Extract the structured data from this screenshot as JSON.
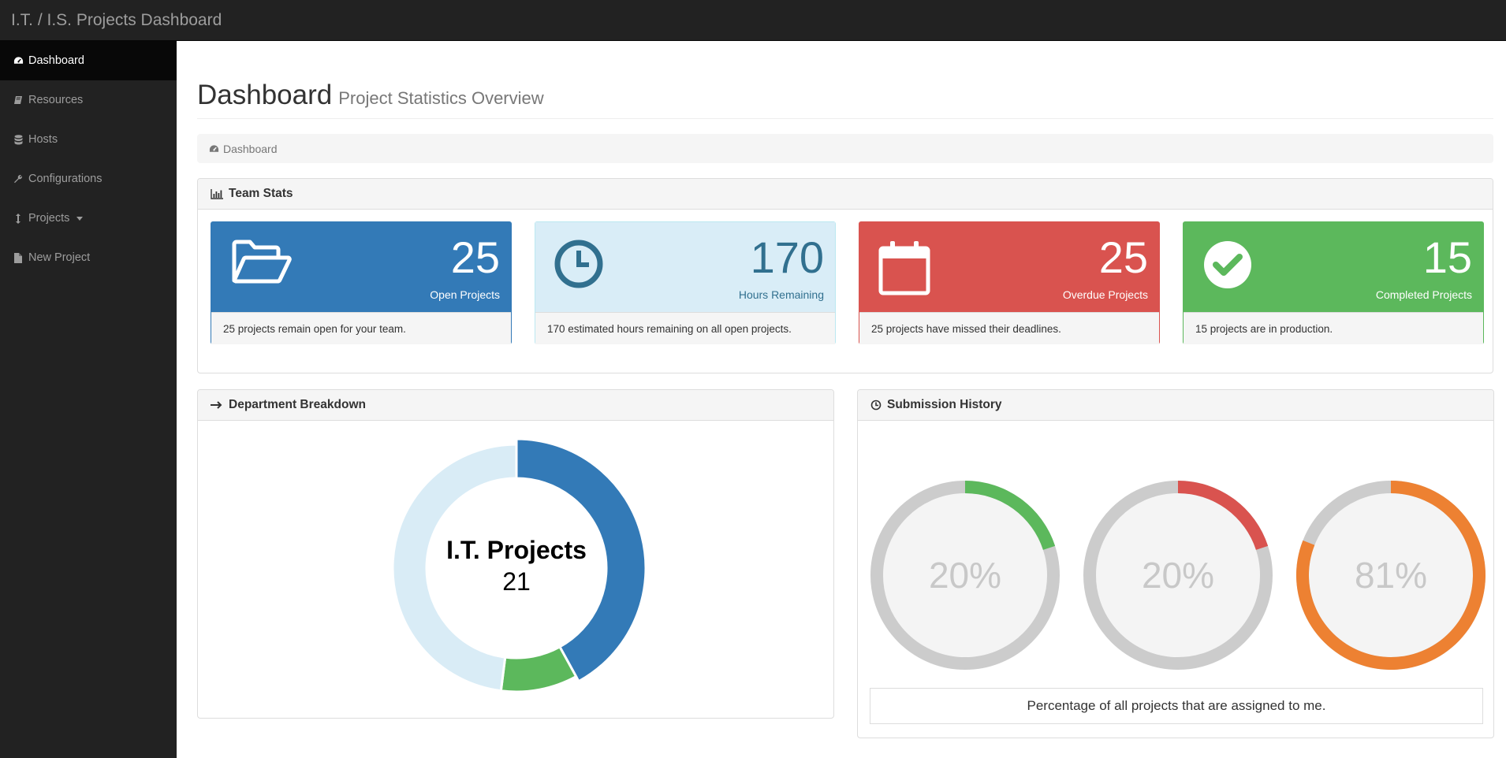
{
  "app": {
    "title": "I.T. / I.S. Projects Dashboard"
  },
  "sidebar": {
    "items": [
      {
        "label": "Dashboard",
        "icon": "dashboard-icon",
        "active": true
      },
      {
        "label": "Resources",
        "icon": "book-icon"
      },
      {
        "label": "Hosts",
        "icon": "database-icon"
      },
      {
        "label": "Configurations",
        "icon": "wrench-icon"
      },
      {
        "label": "Projects",
        "icon": "resize-vertical-icon",
        "dropdown": true
      },
      {
        "label": "New Project",
        "icon": "file-icon"
      }
    ]
  },
  "page": {
    "title": "Dashboard",
    "subtitle": "Project Statistics Overview"
  },
  "breadcrumb": {
    "label": "Dashboard"
  },
  "team_stats": {
    "heading": "Team Stats",
    "cards": [
      {
        "value": "25",
        "label": "Open Projects",
        "footer": "25 projects remain open for your team.",
        "icon": "folder-open-icon",
        "color": "#337ab7"
      },
      {
        "value": "170",
        "label": "Hours Remaining",
        "footer": "170 estimated hours remaining on all open projects.",
        "icon": "clock-icon",
        "color": "#d9edf7"
      },
      {
        "value": "25",
        "label": "Overdue Projects",
        "footer": "25 projects have missed their deadlines.",
        "icon": "calendar-icon",
        "color": "#d9534f"
      },
      {
        "value": "15",
        "label": "Completed Projects",
        "footer": "15 projects are in production.",
        "icon": "check-circle-icon",
        "color": "#5cb85c"
      }
    ]
  },
  "department": {
    "heading": "Department Breakdown",
    "center_title": "I.T. Projects",
    "center_value": "21"
  },
  "submission": {
    "heading": "Submission History",
    "caption": "Percentage of all projects that are assigned to me."
  },
  "chart_data": [
    {
      "type": "pie",
      "variant": "doughnut",
      "center_label": "I.T. Projects",
      "center_value": 21,
      "values": [
        21,
        5,
        24
      ],
      "colors": [
        "#337ab7",
        "#5cb85c",
        "#d9ecf6"
      ],
      "highlighted_index": 0
    },
    {
      "type": "pie",
      "variant": "gauges",
      "values": [
        20,
        20,
        81
      ],
      "labels": [
        "20%",
        "20%",
        "81%"
      ],
      "colors": [
        "#5cb85c",
        "#d9534f",
        "#ed8132"
      ],
      "track_color": "#cccccc"
    }
  ]
}
